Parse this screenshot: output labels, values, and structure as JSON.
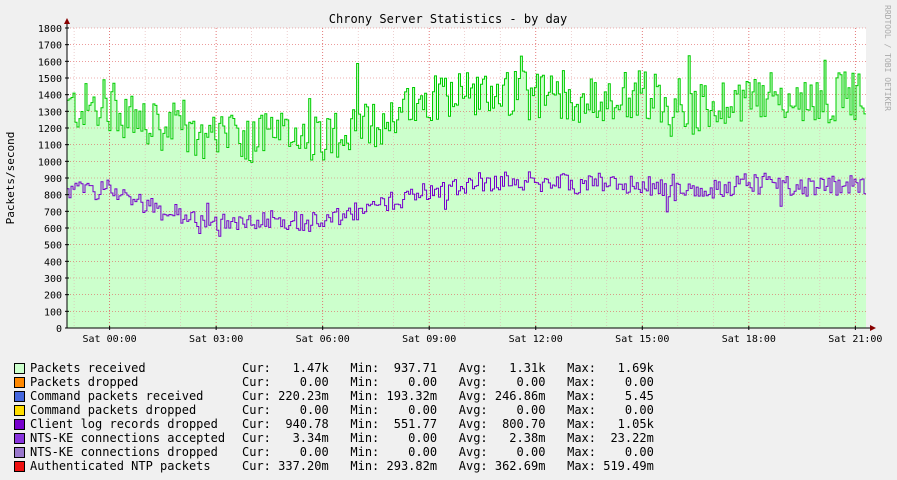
{
  "chart_data": {
    "type": "area",
    "title": "Chrony Server Statistics - by day",
    "ylabel": "Packets/second",
    "watermark": "RRDTOOL / TOBI OETIKER",
    "ylim": [
      0,
      1800
    ],
    "yticks": [
      0,
      100,
      200,
      300,
      400,
      500,
      600,
      700,
      800,
      900,
      1000,
      1100,
      1200,
      1300,
      1400,
      1500,
      1600,
      1700,
      1800
    ],
    "xlim_hours": [
      -1.2,
      21.3
    ],
    "xticks": [
      {
        "label": "Sat 00:00",
        "hour": 0
      },
      {
        "label": "Sat 03:00",
        "hour": 3
      },
      {
        "label": "Sat 06:00",
        "hour": 6
      },
      {
        "label": "Sat 09:00",
        "hour": 9
      },
      {
        "label": "Sat 12:00",
        "hour": 12
      },
      {
        "label": "Sat 15:00",
        "hour": 15
      },
      {
        "label": "Sat 18:00",
        "hour": 18
      },
      {
        "label": "Sat 21:00",
        "hour": 21
      }
    ],
    "grid": true,
    "colors": {
      "background": "#f0f0f0",
      "plot": "#ffffff",
      "area": "#ccffcc",
      "received_line": "#00cc00",
      "client_log_line": "#7700cc",
      "grid_minor": "#e0b0b0",
      "grid_major": "#e06060",
      "arrow": "#880000"
    },
    "series": [
      {
        "name": "Packets received",
        "color": "#ccffcc",
        "cur": "1.47k",
        "min": "937.71",
        "avg": "1.31k",
        "max": "1.69k",
        "profile_hours": [
          -1.2,
          0,
          1.5,
          3,
          4.5,
          6,
          7.5,
          9,
          10.5,
          12,
          13.5,
          15,
          16.5,
          18,
          19.5,
          21.3
        ],
        "profile_values": [
          1320,
          1330,
          1170,
          1120,
          1150,
          1150,
          1220,
          1390,
          1420,
          1400,
          1350,
          1420,
          1300,
          1400,
          1360,
          1400
        ],
        "amplitude": 150
      },
      {
        "name": "Packets dropped",
        "color": "#ff8800",
        "cur": "0.00",
        "min": "0.00",
        "avg": "0.00",
        "max": "0.00"
      },
      {
        "name": "Command packets received",
        "color": "#4466dd",
        "cur": "220.23m",
        "min": "193.32m",
        "avg": "246.86m",
        "max": "5.45"
      },
      {
        "name": "Command packets dropped",
        "color": "#ffdd00",
        "cur": "0.00",
        "min": "0.00",
        "avg": "0.00",
        "max": "0.00"
      },
      {
        "name": "Client log records dropped",
        "color": "#7700cc",
        "cur": "940.78",
        "min": "551.77",
        "avg": "800.70",
        "max": "1.05k",
        "profile_hours": [
          -1.2,
          0,
          1.5,
          3,
          4.5,
          6,
          7.5,
          9,
          10.5,
          12,
          13.5,
          15,
          16.5,
          18,
          19.5,
          21.3
        ],
        "profile_values": [
          820,
          840,
          700,
          640,
          660,
          630,
          730,
          830,
          880,
          880,
          860,
          860,
          800,
          880,
          850,
          860
        ],
        "amplitude": 60
      },
      {
        "name": "NTS-KE connections accepted",
        "color": "#8833dd",
        "cur": "3.34m",
        "min": "0.00",
        "avg": "2.38m",
        "max": "23.22m"
      },
      {
        "name": "NTS-KE connections dropped",
        "color": "#9977cc",
        "cur": "0.00",
        "min": "0.00",
        "avg": "0.00",
        "max": "0.00"
      },
      {
        "name": "Authenticated NTP packets",
        "color": "#ee1111",
        "cur": "337.20m",
        "min": "293.82m",
        "avg": "362.69m",
        "max": "519.49m"
      }
    ],
    "stat_labels": {
      "cur": "Cur:",
      "min": "Min:",
      "avg": "Avg:",
      "max": "Max:"
    }
  }
}
